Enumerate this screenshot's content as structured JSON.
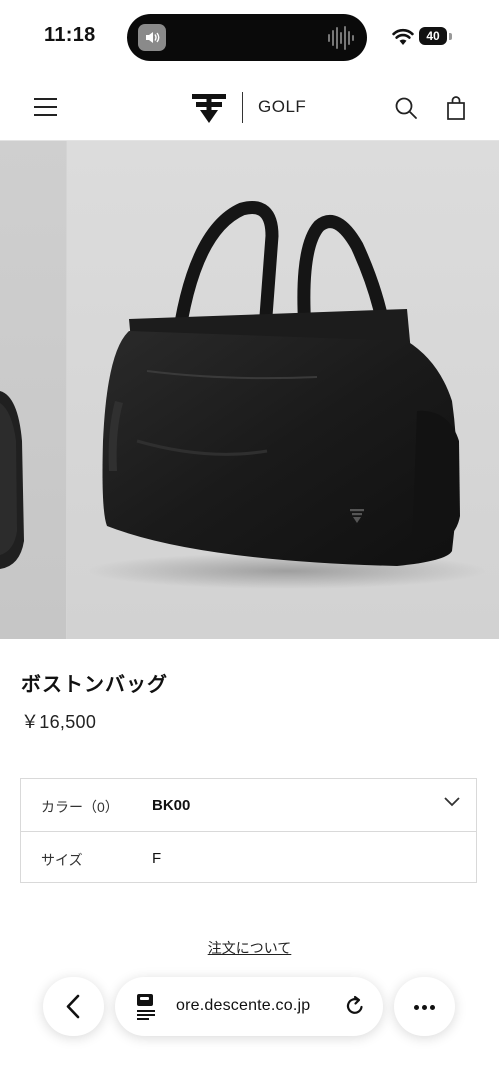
{
  "status_bar": {
    "time": "11:18",
    "battery": "40"
  },
  "header": {
    "brand": "GOLF"
  },
  "product": {
    "name": "ボストンバッグ",
    "price": "￥16,500"
  },
  "options": [
    {
      "label": "カラー（0）",
      "value": "BK00"
    },
    {
      "label": "サイズ",
      "value": "F"
    }
  ],
  "order_link": "注文について",
  "browser": {
    "url": "ore.descente.co.jp"
  }
}
